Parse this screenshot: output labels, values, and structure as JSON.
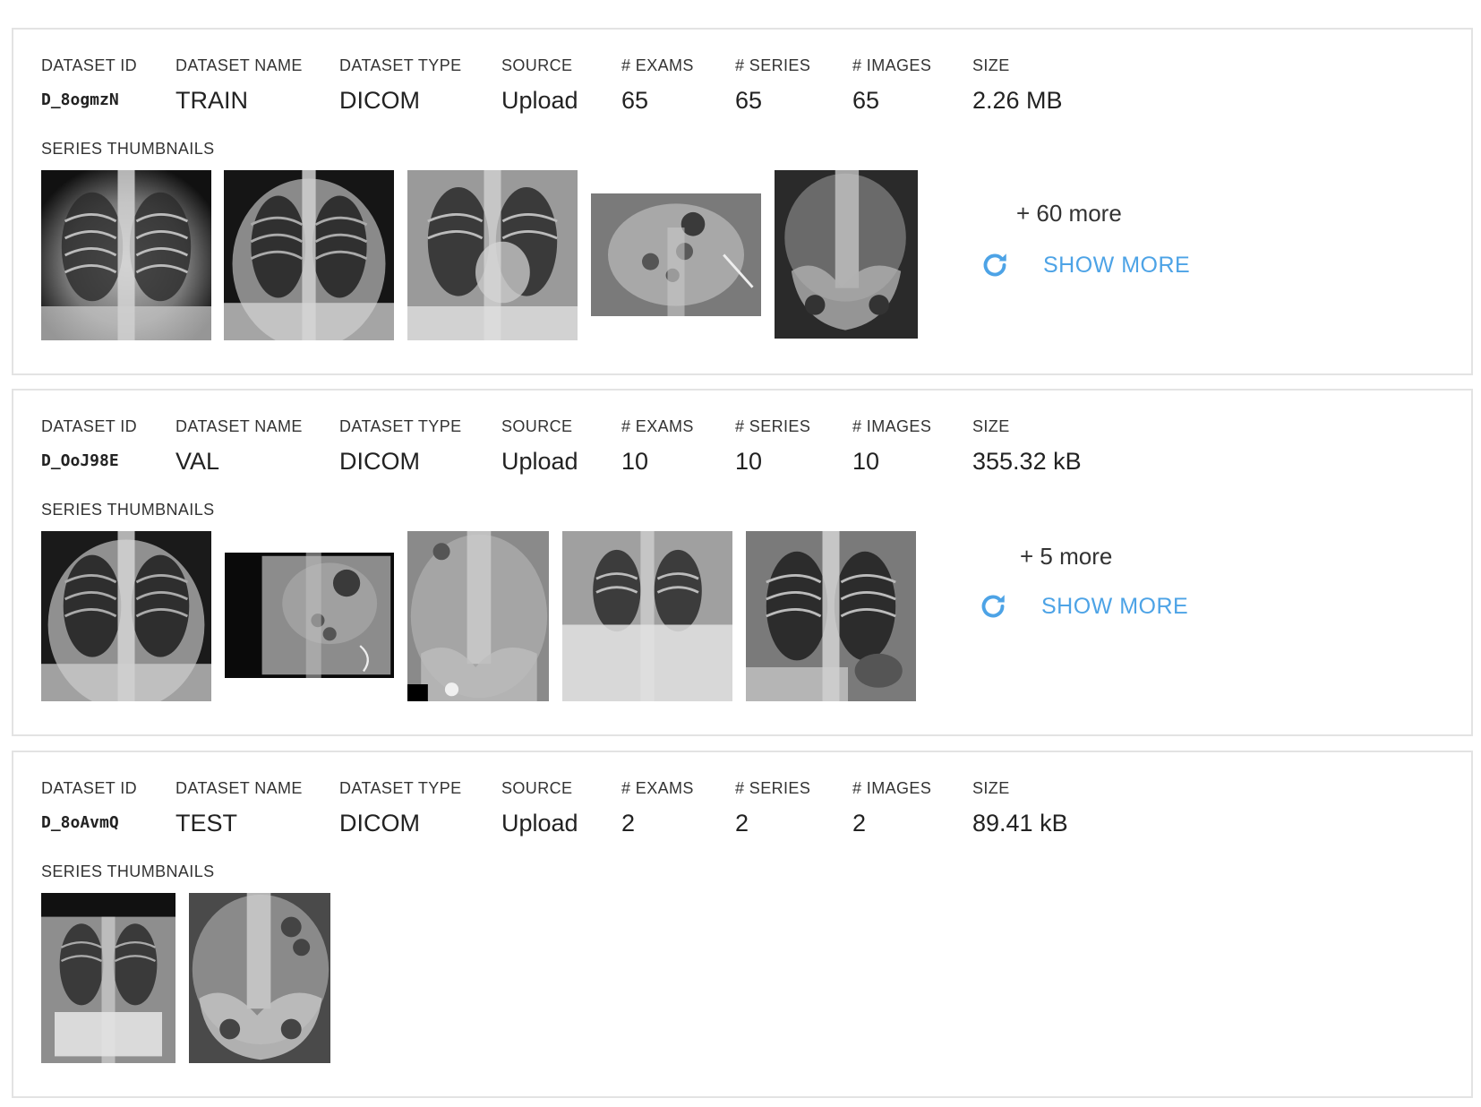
{
  "columns": {
    "id": "DATASET ID",
    "name": "DATASET NAME",
    "type": "DATASET TYPE",
    "source": "SOURCE",
    "exams": "# EXAMS",
    "series": "# SERIES",
    "images": "# IMAGES",
    "size": "SIZE",
    "thumbnails": "SERIES THUMBNAILS"
  },
  "accent_color": "#4da3e6",
  "datasets": [
    {
      "id": "D_8ogmzN",
      "name": "TRAIN",
      "type": "DICOM",
      "source": "Upload",
      "exams": "65",
      "series": "65",
      "images": "65",
      "size": "2.26 MB",
      "thumbnails": [
        "chest-xray",
        "chest-xray",
        "chest-xray",
        "abdomen-xray",
        "pelvis-xray"
      ],
      "more_text": "+ 60 more",
      "show_more_label": "SHOW MORE"
    },
    {
      "id": "D_OoJ98E",
      "name": "VAL",
      "type": "DICOM",
      "source": "Upload",
      "exams": "10",
      "series": "10",
      "images": "10",
      "size": "355.32 kB",
      "thumbnails": [
        "chest-xray",
        "abdomen-xray",
        "spine-xray",
        "chest-xray",
        "chest-xray"
      ],
      "more_text": "+ 5 more",
      "show_more_label": "SHOW MORE"
    },
    {
      "id": "D_8oAvmQ",
      "name": "TEST",
      "type": "DICOM",
      "source": "Upload",
      "exams": "2",
      "series": "2",
      "images": "2",
      "size": "89.41 kB",
      "thumbnails": [
        "chest-xray",
        "pelvis-xray"
      ]
    }
  ]
}
